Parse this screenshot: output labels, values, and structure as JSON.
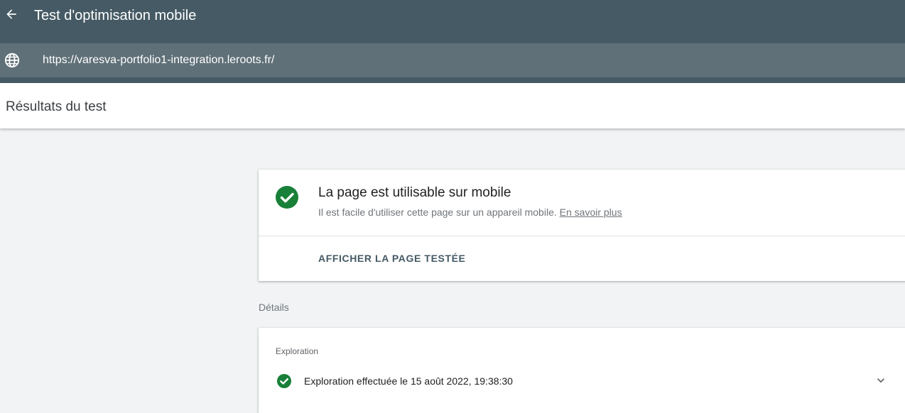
{
  "app": {
    "title": "Test d'optimisation mobile"
  },
  "urlbar": {
    "url": "https://varesva-portfolio1-integration.leroots.fr/"
  },
  "results": {
    "title": "Résultats du test"
  },
  "summary": {
    "status_title": "La page est utilisable sur mobile",
    "description": "Il est facile d'utiliser cette page sur un appareil mobile.",
    "learn_more": "En savoir plus",
    "view_button": "AFFICHER LA PAGE TESTÉE",
    "status_color": "#188038"
  },
  "details": {
    "label": "Détails",
    "section_label": "Exploration",
    "crawl_text": "Exploration effectuée le 15 août 2022, 19:38:30"
  },
  "colors": {
    "appbar": "#455a64",
    "urlbar": "#607078",
    "success": "#188038"
  },
  "icons": {
    "back": "arrow-back-icon",
    "globe": "globe-icon",
    "status": "check-circle-icon",
    "crawl": "check-circle-icon",
    "expand": "chevron-down-icon"
  }
}
